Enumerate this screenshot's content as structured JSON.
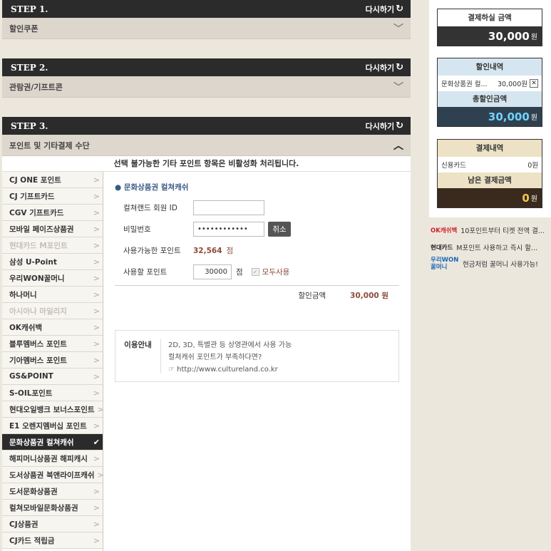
{
  "steps": [
    {
      "title": "STEP 1.",
      "reset": "다시하기",
      "section": "할인쿠폰"
    },
    {
      "title": "STEP 2.",
      "reset": "다시하기",
      "section": "관람권/기프트콘"
    },
    {
      "title": "STEP 3.",
      "reset": "다시하기",
      "section": "포인트 및 기타결제 수단"
    }
  ],
  "notice": "선택 불가능한 기타 포인트 항목은 비활성화 처리됩니다.",
  "side_items": [
    "CJ ONE 포인트",
    "CJ 기프트카드",
    "CGV 기프트카드",
    "모바일 페이즈상품권",
    "현대카드 M포인트",
    "삼성 U-Point",
    "우리WON꿀머니",
    "하나머니",
    "아시아나 마일리지",
    "OK캐쉬백",
    "블루멤버스 포인트",
    "기아멤버스 포인트",
    "GS&POINT",
    "S-OIL포인트",
    "현대오일뱅크 보너스포인트",
    "E1 오렌지멤버십 포인트",
    "문화상품권 컬쳐캐쉬",
    "해피머니상품권 해피캐시",
    "도서상품권 북앤라이프캐쉬",
    "도서문화상품권",
    "컬쳐모바일문화상품권",
    "CJ상품권",
    "CJ카드 적립금"
  ],
  "form": {
    "section_title": "● 문화상품권 컬쳐캐쉬",
    "id_label": "컬쳐랜드 회원 ID",
    "id_value": "",
    "pw_label": "비밀번호",
    "pw_value": "••••••••••••",
    "cancel": "취소",
    "avail_label": "사용가능한 포인트",
    "avail_value": "32,564",
    "avail_unit": "점",
    "use_label": "사용할 포인트",
    "use_value": "30000",
    "use_unit": "점",
    "use_all": "모두사용",
    "discount_label": "할인금액",
    "discount_value": "30,000 원"
  },
  "guide": {
    "title": "이용안내",
    "lines": [
      "2D, 3D, 특별관 등 상영관에서 사용 가능",
      "컬쳐캐쉬 포인트가 부족하다면?",
      "☞ http://www.cultureland.co.kr"
    ]
  },
  "summary": {
    "pay_title": "결제하실 금액",
    "pay_amount": "30,000",
    "won": "원",
    "discount_title": "할인내역",
    "discount_item": "문화상품권 컬...",
    "discount_item_amount": "30,000원",
    "total_discount_title": "총할인금액",
    "total_discount": "30,000",
    "paydetail_title": "결제내역",
    "paydetail_item": "신용카드",
    "paydetail_amount": "0원",
    "remain_title": "남은 결제금액",
    "remain_amount": "0"
  },
  "promos": [
    {
      "tag": "OK캐쉬백",
      "text": "10포인트부터 티켓 전액 결..."
    },
    {
      "tag": "현대카드",
      "text": "M포인트 사용하고 즉시 할..."
    },
    {
      "tag": "우리WON 꿀머니",
      "text": "현금처럼 꿀머니 사용가능!"
    }
  ],
  "colors": {
    "accent_blue": "#6fd3ff",
    "accent_gold": "#f2c94c",
    "points": "#8b4a3a"
  }
}
